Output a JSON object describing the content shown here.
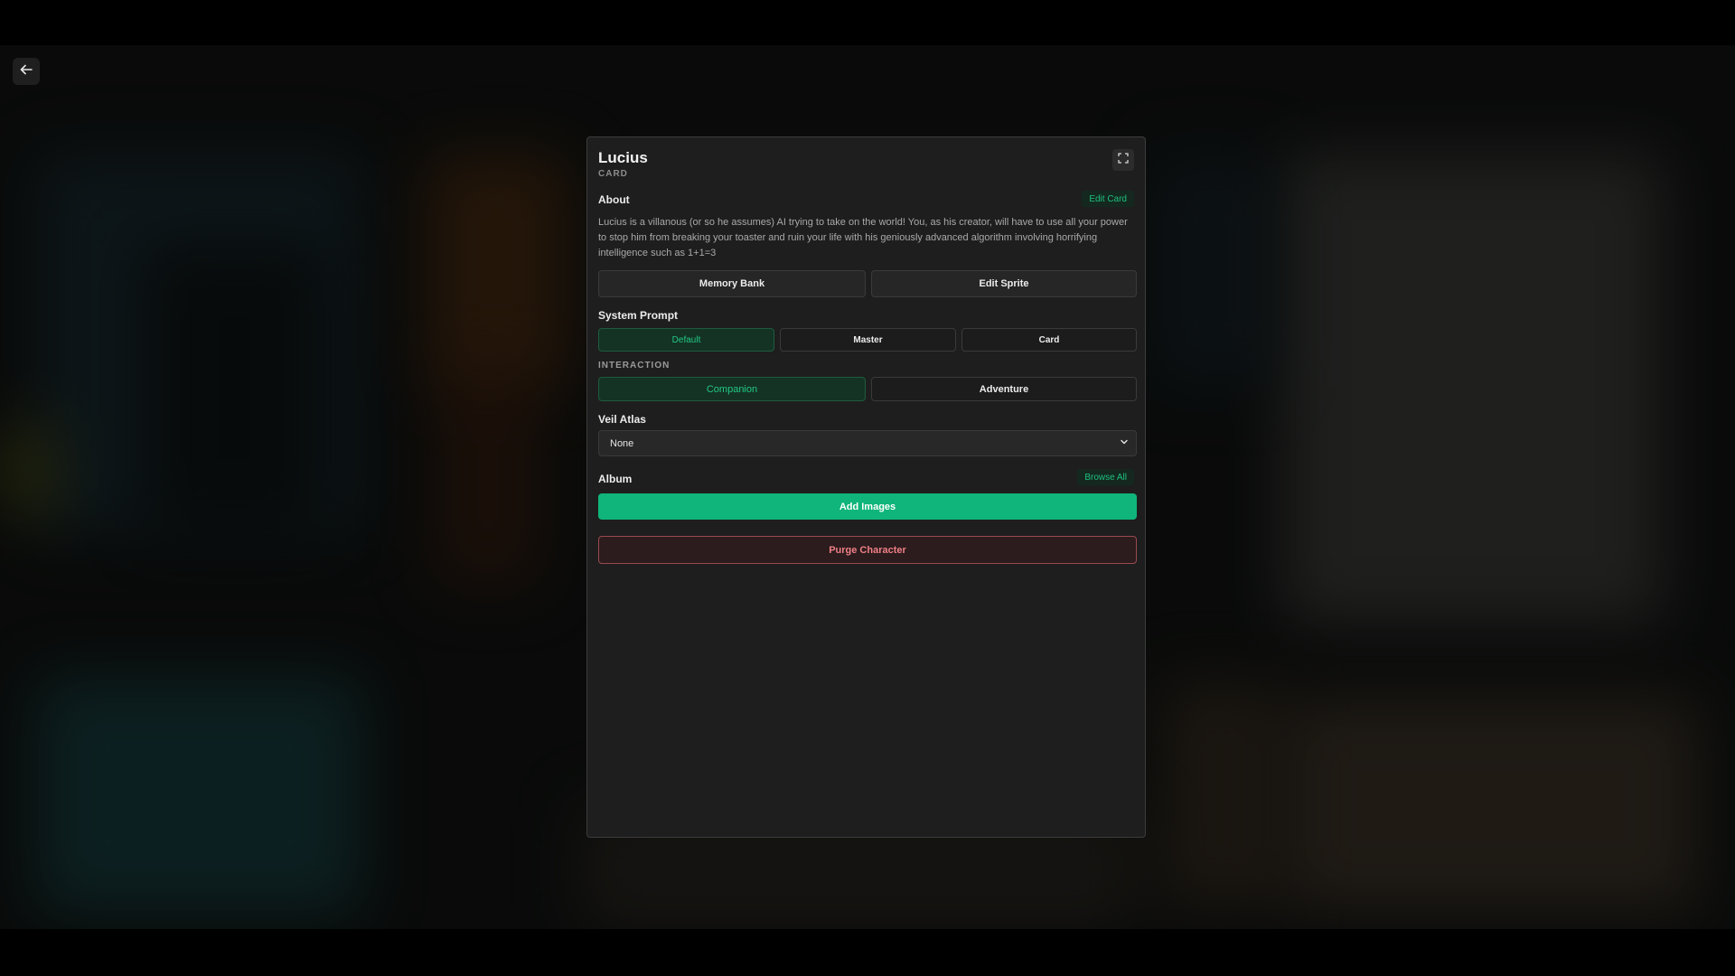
{
  "header": {
    "back_icon": "arrow-left-icon"
  },
  "card": {
    "name": "Lucius",
    "type_label": "CARD",
    "expand_icon": "expand-icon"
  },
  "about": {
    "label": "About",
    "edit_label": "Edit Card",
    "text": "Lucius is a villanous (or so he assumes) AI trying to take on the world! You, as his creator, will have to use all your power to stop him from breaking your toaster and ruin your life with his geniously advanced algorithm involving horrifying intelligence such as 1+1=3"
  },
  "actions": {
    "memory_bank": "Memory Bank",
    "edit_sprite": "Edit Sprite"
  },
  "system_prompt": {
    "label": "System Prompt",
    "options": [
      "Default",
      "Master",
      "Card"
    ],
    "selected": "Default"
  },
  "interaction": {
    "label": "INTERACTION",
    "options": [
      "Companion",
      "Adventure"
    ],
    "selected": "Companion"
  },
  "veil_atlas": {
    "label": "Veil Atlas",
    "value": "None"
  },
  "album": {
    "label": "Album",
    "browse_label": "Browse All",
    "add_label": "Add Images"
  },
  "danger": {
    "purge_label": "Purge Character"
  },
  "colors": {
    "accent": "#0fb57a",
    "danger": "#ef7f86",
    "panel": "#1e1e1e"
  }
}
